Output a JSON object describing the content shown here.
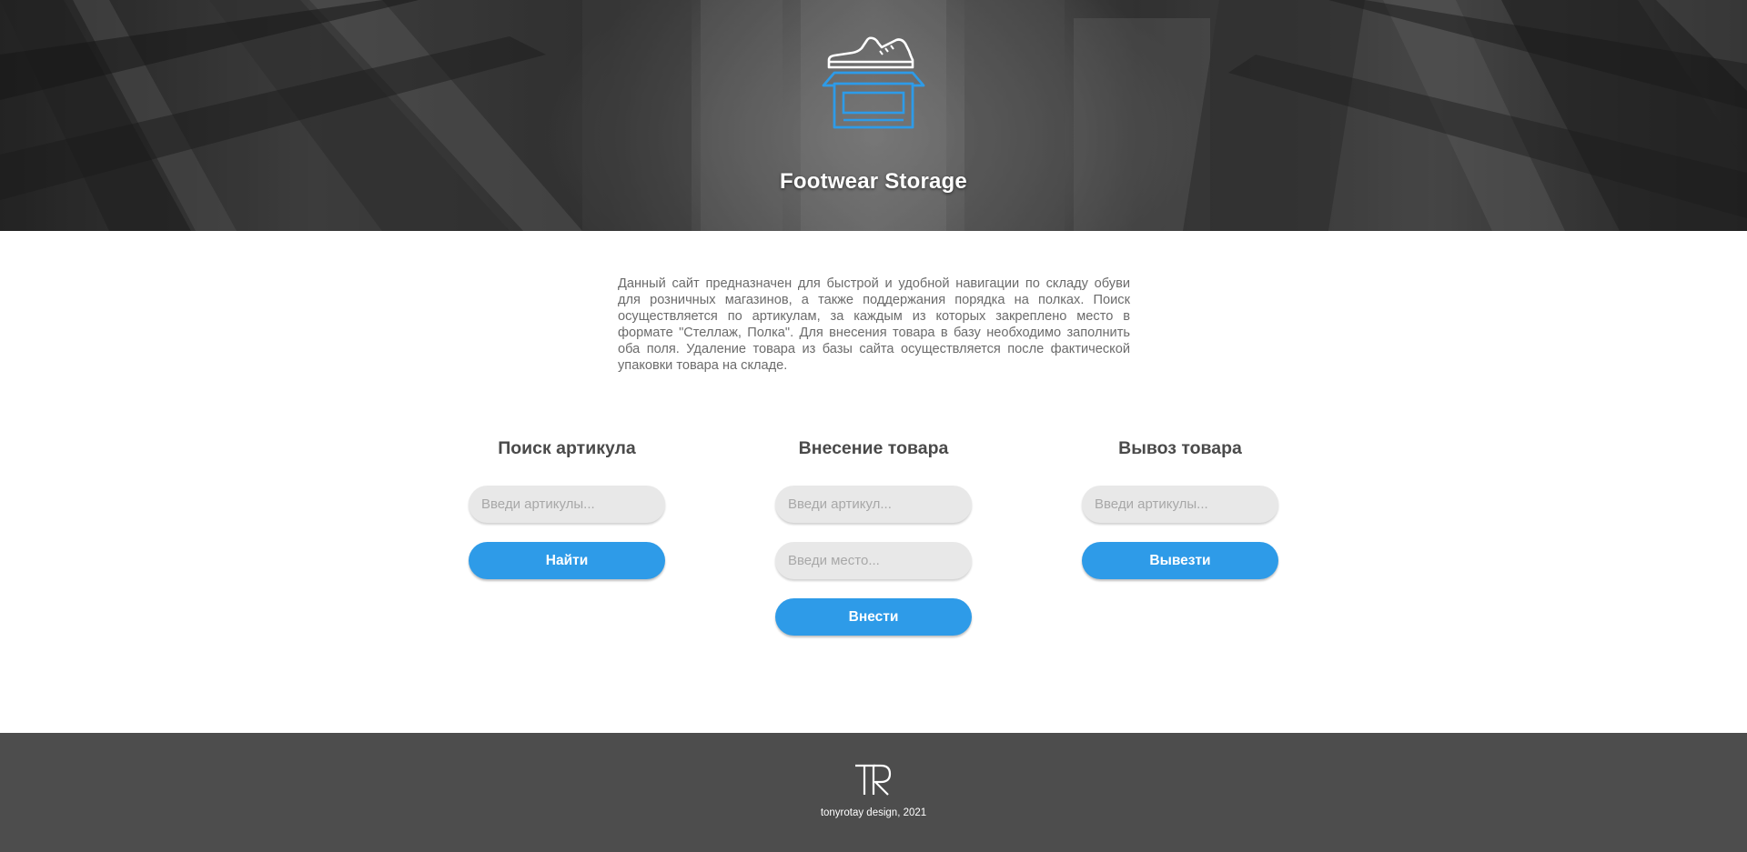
{
  "hero": {
    "title": "Footwear Storage",
    "logo_icon": "shoe-box-icon",
    "accent_color": "#2e9be8"
  },
  "description": "Данный сайт предназначен для быстрой и удобной навигации по складу обуви для розничных магазинов, а также поддержания порядка на полках. Поиск осуществляется по артикулам, за каждым из которых закреплено место в формате \"Стеллаж, Полка\". Для внесения товара в базу необходимо заполнить оба поля. Удаление товара из базы сайта осуществляется после фактической упаковки товара на складе.",
  "search": {
    "heading": "Поиск артикула",
    "input_placeholder": "Введи артикулы...",
    "input_value": "",
    "button_label": "Найти"
  },
  "add": {
    "heading": "Внесение товара",
    "article_placeholder": "Введи артикул...",
    "article_value": "",
    "place_placeholder": "Введи место...",
    "place_value": "",
    "button_label": "Внести"
  },
  "remove": {
    "heading": "Вывоз товара",
    "input_placeholder": "Введи артикулы...",
    "input_value": "",
    "button_label": "Вывезти"
  },
  "footer": {
    "logo_icon": "tr-monogram-icon",
    "copyright": "tonyrotay design, 2021",
    "background": "#4d4d4d"
  }
}
